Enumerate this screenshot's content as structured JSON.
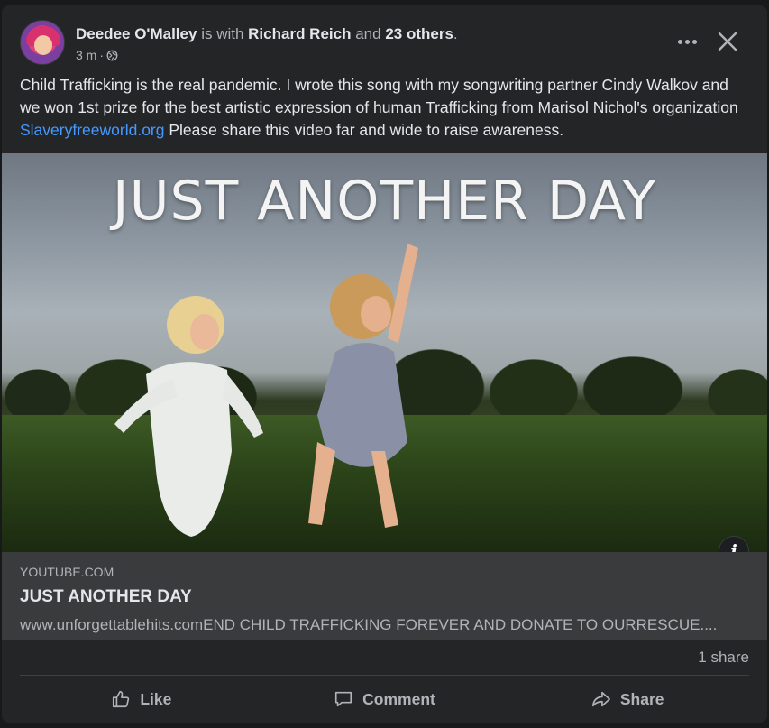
{
  "post": {
    "author": "Deedee O'Malley",
    "with_text": "is with",
    "tagged_person": "Richard Reich",
    "and_text": "and",
    "others": "23 others",
    "period": ".",
    "time": "3 m",
    "dot": "·",
    "text_before_link": "Child Trafficking is the real pandemic. I wrote this song with my songwriting partner Cindy Walkov and we won 1st prize for the best artistic expression of human Trafficking from Marisol Nichol's organization ",
    "text_link": "Slaveryfreeworld.org",
    "text_after_link": "  Please share this video far and wide to raise awareness.",
    "image_title": "JUST ANOTHER DAY",
    "link": {
      "domain": "YOUTUBE.COM",
      "title": "JUST ANOTHER DAY",
      "description": "www.unforgettablehits.comEND CHILD TRAFFICKING FOREVER AND DONATE TO OURRESCUE...."
    },
    "shares": "1 share",
    "actions": {
      "like": "Like",
      "comment": "Comment",
      "share": "Share"
    }
  },
  "icons": {
    "more": "more-icon",
    "close": "close-icon",
    "globe": "globe-icon",
    "info": "info-icon",
    "like": "thumbs-up-icon",
    "comment": "comment-bubble-icon",
    "share": "share-arrow-icon"
  },
  "colors": {
    "background": "#18191a",
    "card": "#242526",
    "link": "#4599ff",
    "secondary_text": "#b0b3b8",
    "primary_text": "#e4e6eb"
  }
}
